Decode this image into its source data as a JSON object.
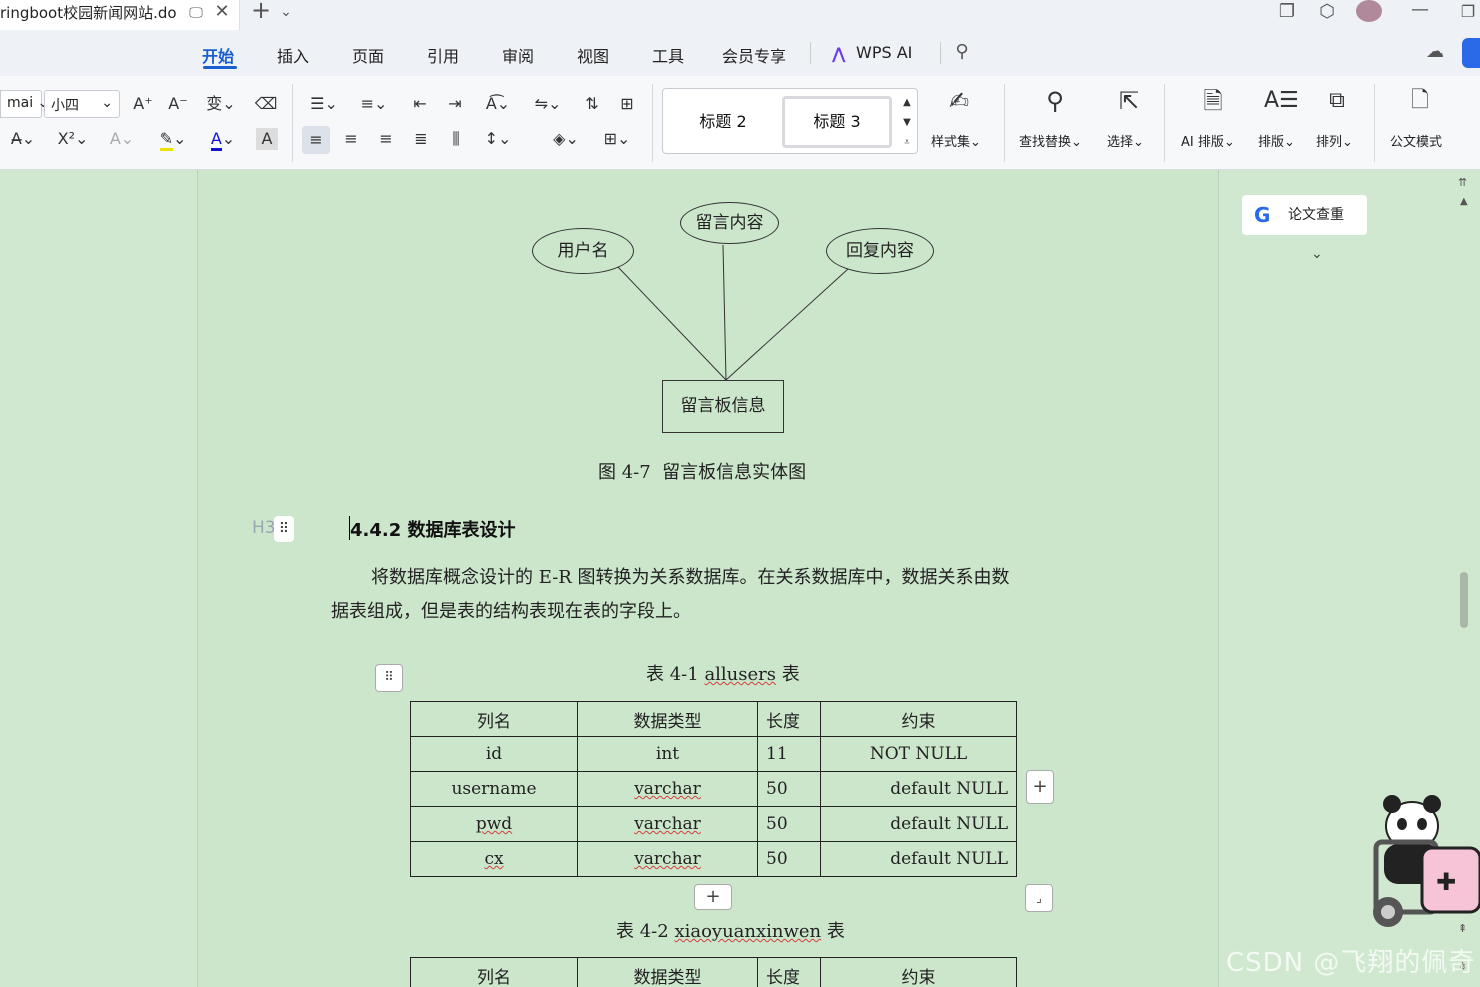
{
  "window": {
    "tab_title": "ringboot校园新闻网站.do",
    "new_tab": "+",
    "tab_dropdown": "⌄"
  },
  "menu": {
    "items": [
      "开始",
      "插入",
      "页面",
      "引用",
      "审阅",
      "视图",
      "工具",
      "会员专享",
      "WPS AI"
    ],
    "active": "开始"
  },
  "ribbon": {
    "font_name": "mai",
    "font_size": "小四",
    "styles": [
      "标题 2",
      "标题 3"
    ],
    "style_set_label": "样式集",
    "find_replace_label": "查找替换",
    "select_label": "选择",
    "ai_layout_label": "AI 排版",
    "layout_label": "排版",
    "arrange_label": "排列",
    "official_mode_label": "公文模式"
  },
  "document": {
    "er_diagram": {
      "attributes": [
        "用户名",
        "留言内容",
        "回复内容"
      ],
      "entity": "留言板信息",
      "caption": "图 4-7  留言板信息实体图"
    },
    "heading_marker": "H3",
    "heading": "4.4.2 数据库表设计",
    "paragraph_line1": "将数据库概念设计的 E-R 图转换为关系数据库。在关系数据库中，数据关系由数",
    "paragraph_line2": "据表组成，但是表的结构表现在表的字段上。",
    "table1": {
      "caption_prefix": "表 4-1 ",
      "caption_name": "allusers",
      "caption_suffix": " 表",
      "headers": [
        "列名",
        "数据类型",
        "长度",
        "约束"
      ],
      "rows": [
        [
          "id",
          "int",
          "11",
          "NOT NULL"
        ],
        [
          "username",
          "varchar",
          "50",
          "default NULL"
        ],
        [
          "pwd",
          "varchar",
          "50",
          "default NULL"
        ],
        [
          "cx",
          "varchar",
          "50",
          "default NULL"
        ]
      ]
    },
    "table2": {
      "caption_prefix": "表 4-2 ",
      "caption_name": "xiaoyuanxinwen",
      "caption_suffix": " 表",
      "headers": [
        "列名",
        "数据类型",
        "长度",
        "约束"
      ]
    }
  },
  "right_panel": {
    "check_button": "论文查重"
  },
  "watermark": "CSDN @飞翔的佩奇"
}
